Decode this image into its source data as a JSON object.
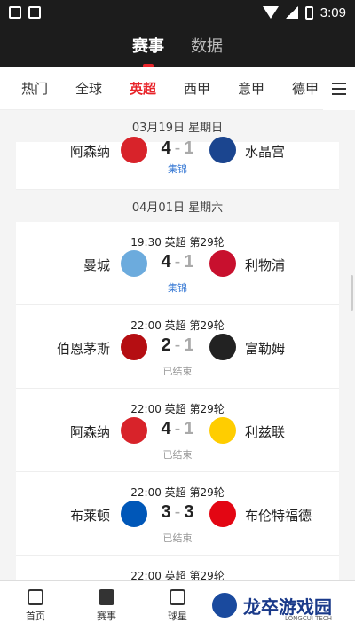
{
  "status_bar": {
    "time": "3:09"
  },
  "header": {
    "tabs": [
      {
        "label": "赛事"
      },
      {
        "label": "数据"
      }
    ]
  },
  "leagues": [
    "热门",
    "全球",
    "英超",
    "西甲",
    "意甲",
    "德甲"
  ],
  "dates": [
    "03月19日 星期日",
    "04月01日 星期六"
  ],
  "matches": [
    {
      "home": "阿森纳",
      "away": "水晶宫",
      "home_score": "4",
      "away_score": "1",
      "status": "集锦",
      "home_color": "#d8232a",
      "away_color": "#1b458f"
    },
    {
      "meta": "19:30  英超  第29轮",
      "home": "曼城",
      "away": "利物浦",
      "home_score": "4",
      "away_score": "1",
      "status": "集锦",
      "home_color": "#6cabdd",
      "away_color": "#c8102e"
    },
    {
      "meta": "22:00  英超  第29轮",
      "home": "伯恩茅斯",
      "away": "富勒姆",
      "home_score": "2",
      "away_score": "1",
      "status": "已结束",
      "home_color": "#b50e12",
      "away_color": "#222222"
    },
    {
      "meta": "22:00  英超  第29轮",
      "home": "阿森纳",
      "away": "利兹联",
      "home_score": "4",
      "away_score": "1",
      "status": "已结束",
      "home_color": "#d8232a",
      "away_color": "#ffcd00"
    },
    {
      "meta": "22:00  英超  第29轮",
      "home": "布莱顿",
      "away": "布伦特福德",
      "home_score": "3",
      "away_score": "3",
      "status": "已结束",
      "home_color": "#0057b8",
      "away_color": "#e30613"
    },
    {
      "meta": "22:00  英超  第29轮"
    }
  ],
  "bottom_nav": [
    {
      "label": "首页"
    },
    {
      "label": "赛事"
    },
    {
      "label": "球星"
    }
  ],
  "watermark": {
    "title": "龙卒游戏园",
    "subtitle": "LONGCUI TECH"
  }
}
